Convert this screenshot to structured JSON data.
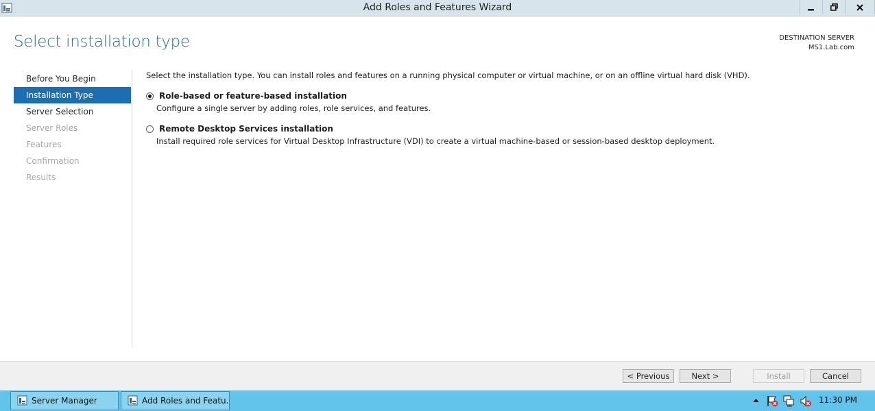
{
  "window": {
    "title": "Add Roles and Features Wizard"
  },
  "header": {
    "page_title": "Select installation type",
    "destination_label": "DESTINATION SERVER",
    "destination_value": "MS1.Lab.com"
  },
  "nav": {
    "items": [
      {
        "label": "Before You Begin",
        "state": "normal"
      },
      {
        "label": "Installation Type",
        "state": "active"
      },
      {
        "label": "Server Selection",
        "state": "normal"
      },
      {
        "label": "Server Roles",
        "state": "disabled"
      },
      {
        "label": "Features",
        "state": "disabled"
      },
      {
        "label": "Confirmation",
        "state": "disabled"
      },
      {
        "label": "Results",
        "state": "disabled"
      }
    ]
  },
  "main": {
    "intro": "Select the installation type. You can install roles and features on a running physical computer or virtual machine, or on an offline virtual hard disk (VHD).",
    "options": [
      {
        "label": "Role-based or feature-based installation",
        "description": "Configure a single server by adding roles, role services, and features.",
        "selected": true
      },
      {
        "label": "Remote Desktop Services installation",
        "description": "Install required role services for Virtual Desktop Infrastructure (VDI) to create a virtual machine-based or session-based desktop deployment.",
        "selected": false
      }
    ]
  },
  "footer": {
    "previous": "< Previous",
    "next": "Next >",
    "install": "Install",
    "cancel": "Cancel"
  },
  "taskbar": {
    "items": [
      {
        "label": "Server Manager"
      },
      {
        "label": "Add Roles and Featu..."
      }
    ],
    "clock": "11:30 PM"
  },
  "colors": {
    "accent": "#1b6fb0",
    "title_blue": "#1f6a98",
    "taskbar": "#62c4ea"
  }
}
